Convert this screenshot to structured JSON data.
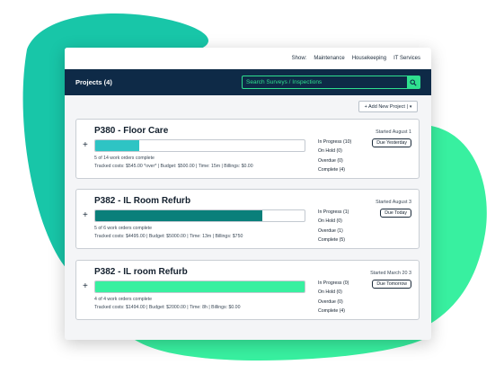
{
  "topnav": {
    "show_label": "Show:",
    "links": [
      "Maintenance",
      "Housekeeping",
      "IT Services"
    ]
  },
  "header": {
    "title": "Projects (4)",
    "search_placeholder": "Search Surveys / Inspections"
  },
  "toolbar": {
    "add_label": "+ Add New Project |",
    "add_caret": "▾"
  },
  "colors": {
    "navy": "#0e2a47",
    "green_accent": "#2fe08f",
    "teal_light": "#2ec4c4",
    "teal_dark": "#0a7f7a",
    "mint": "#38f0a0"
  },
  "projects": [
    {
      "title": "P380 - Floor Care",
      "progress": 0.21,
      "fill_color": "#2ec4c4",
      "work_orders": "5 of 14 work orders complete",
      "costs": "Tracked costs: $545.00 *over* | Budget: $500.00 | Time: 15m | Billings: $0.00",
      "statuses": [
        "In Progress (10)",
        "On Hold (0)",
        "Overdue (0)",
        "Complete (4)"
      ],
      "started": "Started August 1",
      "due": "Due Yesterday"
    },
    {
      "title": "P382 - IL Room Refurb",
      "progress": 0.8,
      "fill_color": "#0a7f7a",
      "work_orders": "5 of 6 work orders complete",
      "costs": "Tracked costs: $4495.00 | Budget: $5000.00 | Time: 13m | Billings: $750",
      "statuses": [
        "In Progress (1)",
        "On Hold (0)",
        "Overdue (1)",
        "Complete (5)"
      ],
      "started": "Started August 3",
      "due": "Due Today"
    },
    {
      "title": "P382 - IL room Refurb",
      "progress": 1.0,
      "fill_color": "#38f0a0",
      "work_orders": "4 of 4 work orders complete",
      "costs": "Tracked costs: $1494.00 | Budget: $2000.00 | Time: 8h | Billings: $0.00",
      "statuses": [
        "In Progress (0)",
        "On Hold (0)",
        "Overdue (0)",
        "Complete (4)"
      ],
      "started": "Started March 20 3",
      "due": "Due Tomorrow"
    }
  ]
}
